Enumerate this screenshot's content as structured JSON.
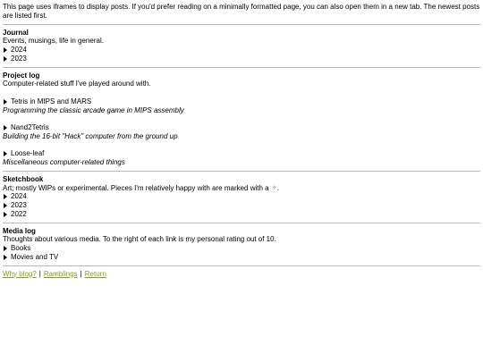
{
  "intro": "This page uses iframes to display posts. If you'd prefer reading on a minimally formatted page, you can also open them in a new tab. The newest posts are listed first.",
  "journal": {
    "title": "Journal",
    "desc": "Events, musings, life in general.",
    "items": [
      "2024",
      "2023"
    ]
  },
  "project_log": {
    "title": "Project log",
    "desc": "Computer-related stuff I've played around with.",
    "projects": [
      {
        "label": "Tetris in MIPS and MARS",
        "desc": "Programming the classic arcade game in MIPS assembly"
      },
      {
        "label": "Nand2Tetris",
        "desc": "Building the 16-bit \"Hack\" computer from the ground up"
      },
      {
        "label": "Loose-leaf",
        "desc": "Miscellaneous computer-related things"
      }
    ]
  },
  "sketchbook": {
    "title": "Sketchbook",
    "desc": "Art; mostly WIPs or experimental. Pieces I'm relatively happy with are marked with a",
    "desc_end": ".",
    "marker_icon": "sparkle-icon",
    "marker_color": "#2e8b57",
    "items": [
      "2024",
      "2023",
      "2022"
    ]
  },
  "media_log": {
    "title": "Media log",
    "desc": "Thoughts about various media. To the right of each link is my personal rating out of 10.",
    "items": [
      "Books",
      "Movies and TV"
    ]
  },
  "footer": {
    "links": [
      "Why blog?",
      "Ramblings",
      "Return"
    ],
    "separator": "|",
    "link_color": "#8a9a1a"
  }
}
